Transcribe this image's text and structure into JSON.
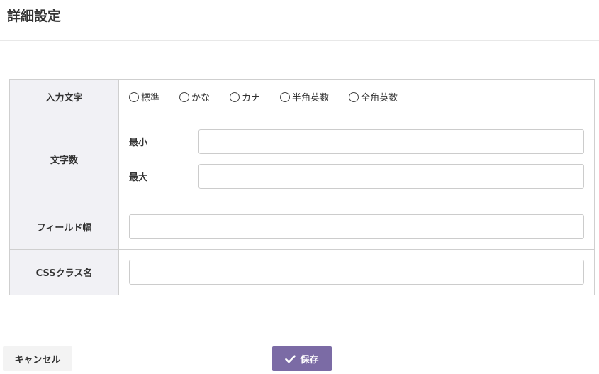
{
  "header": {
    "title": "詳細設定"
  },
  "form": {
    "input_type": {
      "label": "入力文字",
      "options": [
        "標準",
        "かな",
        "カナ",
        "半角英数",
        "全角英数"
      ]
    },
    "length": {
      "label": "文字数",
      "min_label": "最小",
      "max_label": "最大",
      "min_value": "",
      "max_value": ""
    },
    "field_width": {
      "label": "フィールド幅",
      "value": ""
    },
    "css_class": {
      "label": "CSSクラス名",
      "value": ""
    }
  },
  "footer": {
    "cancel_label": "キャンセル",
    "save_label": "保存"
  },
  "colors": {
    "accent": "#7b6ba5",
    "header_cell_bg": "#f1f1f5",
    "border": "#cfcfcf"
  },
  "icons": {
    "save": "check-icon"
  }
}
